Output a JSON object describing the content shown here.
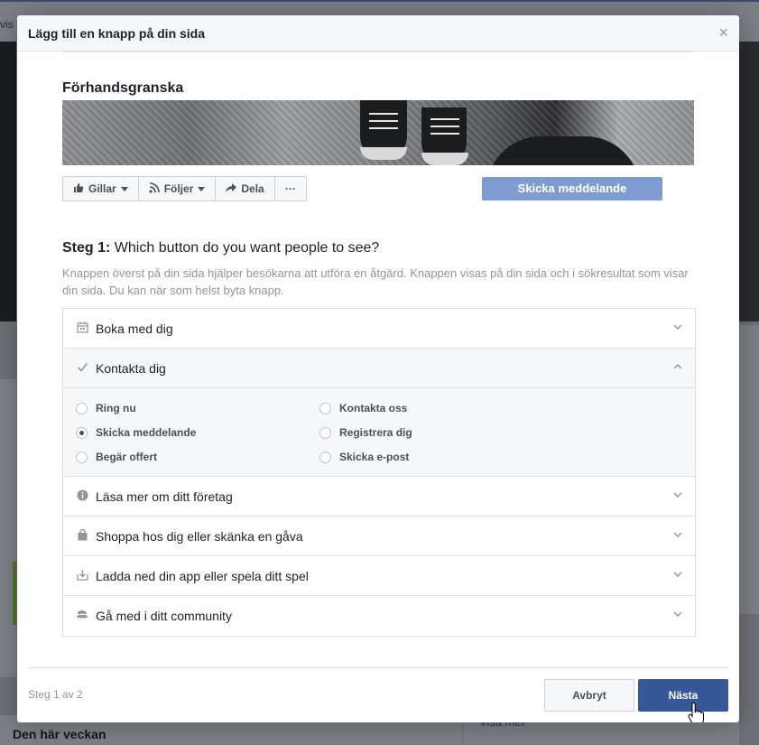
{
  "background": {
    "topbar_peek": "vis",
    "this_week_heading": "Den här veckan",
    "see_more": "Visa mer"
  },
  "dialog": {
    "title": "Lägg till en knapp på din sida",
    "close_glyph": "×",
    "preview": {
      "heading": "Förhandsgranska",
      "actions": [
        {
          "label": "Gillar",
          "icon": "thumbs-up-icon"
        },
        {
          "label": "Följer",
          "icon": "rss-icon"
        },
        {
          "label": "Dela",
          "icon": "share-arrow-icon"
        },
        {
          "label": "···",
          "icon": "more-icon"
        }
      ],
      "cta_label": "Skicka meddelande"
    },
    "step": {
      "prefix": "Steg 1:",
      "question": "Which button do you want people to see?",
      "description": "Knappen överst på din sida hjälper besökarna att utföra en åtgärd. Knappen visas på din sida och i sökresultat som visar din sida. Du kan när som helst byta knapp."
    },
    "categories": [
      {
        "label": "Boka med dig",
        "icon": "calendar-icon",
        "expanded": false
      },
      {
        "label": "Kontakta dig",
        "icon": "checkmark-icon",
        "expanded": true
      },
      {
        "label": "Läsa mer om ditt företag",
        "icon": "info-icon",
        "expanded": false
      },
      {
        "label": "Shoppa hos dig eller skänka en gåva",
        "icon": "shopping-bag-icon",
        "expanded": false
      },
      {
        "label": "Ladda ned din app eller spela ditt spel",
        "icon": "download-icon",
        "expanded": false
      },
      {
        "label": "Gå med i ditt community",
        "icon": "people-icon",
        "expanded": false
      }
    ],
    "contact_options": {
      "ring_nu": "Ring nu",
      "kontakta_oss": "Kontakta oss",
      "skicka_meddelande": "Skicka meddelande",
      "registrera_dig": "Registrera dig",
      "begar_offert": "Begär offert",
      "skicka_epost": "Skicka e-post",
      "selected": "Skicka meddelande"
    },
    "footer": {
      "step_count": "Steg 1 av 2",
      "cancel_label": "Avbryt",
      "next_label": "Nästa"
    },
    "colors": {
      "primary": "#365899",
      "cta_preview": "#7f9bd0",
      "muted_text": "#90949c"
    }
  }
}
